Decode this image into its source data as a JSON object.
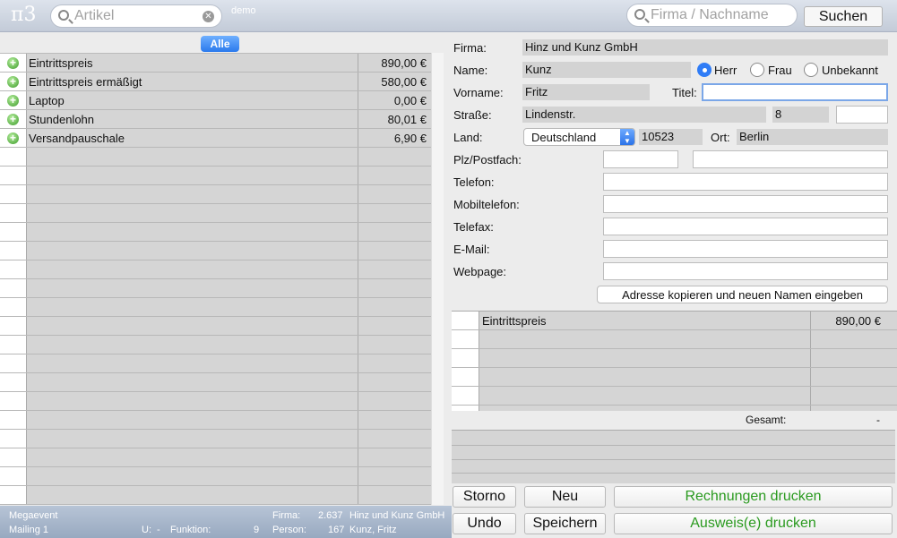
{
  "app": {
    "logo": "π3",
    "mode": "demo"
  },
  "search": {
    "article_placeholder": "Artikel",
    "company_placeholder": "Firma / Nachname",
    "search_button": "Suchen"
  },
  "article_filter": "Alle",
  "articles": [
    {
      "name": "Eintrittspreis",
      "price": "890,00 €"
    },
    {
      "name": "Eintrittspreis ermäßigt",
      "price": "580,00 €"
    },
    {
      "name": "Laptop",
      "price": "0,00 €"
    },
    {
      "name": "Stundenlohn",
      "price": "80,01 €"
    },
    {
      "name": "Versandpauschale",
      "price": "6,90 €"
    }
  ],
  "form": {
    "firma_label": "Firma:",
    "firma": "Hinz und Kunz GmbH",
    "name_label": "Name:",
    "name": "Kunz",
    "salutation": {
      "herr": "Herr",
      "frau": "Frau",
      "unbekannt": "Unbekannt",
      "selected": "herr"
    },
    "vorname_label": "Vorname:",
    "vorname": "Fritz",
    "titel_label": "Titel:",
    "titel": "",
    "strasse_label": "Straße:",
    "strasse": "Lindenstr.",
    "hausnummer": "8",
    "zusatz": "",
    "land_label": "Land:",
    "land": "Deutschland",
    "plz": "10523",
    "ort_label": "Ort:",
    "ort": "Berlin",
    "postfach_label": "Plz/Postfach:",
    "postfach_plz": "",
    "postfach": "",
    "telefon_label": "Telefon:",
    "telefon": "",
    "mobil_label": "Mobiltelefon:",
    "mobil": "",
    "telefax_label": "Telefax:",
    "telefax": "",
    "email_label": "E-Mail:",
    "email": "",
    "webpage_label": "Webpage:",
    "webpage": "",
    "copy_button": "Adresse kopieren und neuen Namen eingeben"
  },
  "order": {
    "items": [
      {
        "name": "Eintrittspreis",
        "price": "890,00 €"
      }
    ],
    "total_label": "Gesamt:",
    "total": "-"
  },
  "buttons": {
    "storno": "Storno",
    "neu": "Neu",
    "rechnungen": "Rechnungen drucken",
    "undo": "Undo",
    "speichern": "Speichern",
    "ausweis": "Ausweis(e) drucken"
  },
  "status": {
    "event": "Megaevent",
    "mailing": "Mailing 1",
    "u_label": "U:",
    "u_value": "-",
    "funktion_label": "Funktion:",
    "funktion_value": "9",
    "firma_label": "Firma:",
    "firma_count": "2.637",
    "firma_name": "Hinz und Kunz GmbH",
    "person_label": "Person:",
    "person_count": "167",
    "person_name": "Kunz, Fritz"
  },
  "colors": {
    "accent": "#2f7cf6",
    "action_green": "#2a9a1f",
    "readonly_gray": "#d3d3d3"
  }
}
